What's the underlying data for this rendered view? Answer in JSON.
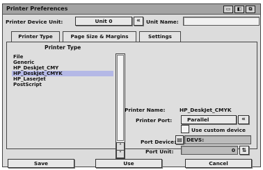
{
  "window": {
    "title": "Printer Preferences",
    "title_buttons": [
      "▭",
      "◧",
      "⧉"
    ]
  },
  "device_bar": {
    "unit_label": "Printer Device Unit:",
    "unit_value": "Unit 0",
    "nav_button": "«",
    "unit_name_label": "Unit Name:",
    "unit_name_value": ""
  },
  "tabs": [
    {
      "label": "Printer Type",
      "active": true
    },
    {
      "label": "Page Size & Margins",
      "active": false
    },
    {
      "label": "Settings",
      "active": false
    }
  ],
  "printer_type": {
    "list_header": "Printer Type",
    "items": [
      {
        "label": "File",
        "selected": false
      },
      {
        "label": "Generic",
        "selected": false
      },
      {
        "label": "HP_DeskJet_CMY",
        "selected": false
      },
      {
        "label": "HP_DeskJet_CMYK",
        "selected": true
      },
      {
        "label": "HP_LaserJet",
        "selected": false
      },
      {
        "label": "PostScript",
        "selected": false
      }
    ]
  },
  "details": {
    "printer_name_label": "Printer Name:",
    "printer_name_value": "HP_DeskJet_CMYK",
    "printer_port_label": "Printer Port:",
    "printer_port_value": "Parallel",
    "port_button": "«",
    "use_custom_device_label": "Use custom device",
    "use_custom_device_checked": false,
    "port_device_label": "Port Device:",
    "port_device_value": "DEVS:",
    "port_unit_label": "Port Unit:",
    "port_unit_value": "0"
  },
  "footer": {
    "save_label": "Save",
    "use_label": "Use",
    "cancel_label": "Cancel"
  },
  "icons": {
    "scroll_up": "˄",
    "scroll_down": "˅",
    "spinner": "⇅",
    "file_requester": "▤"
  }
}
